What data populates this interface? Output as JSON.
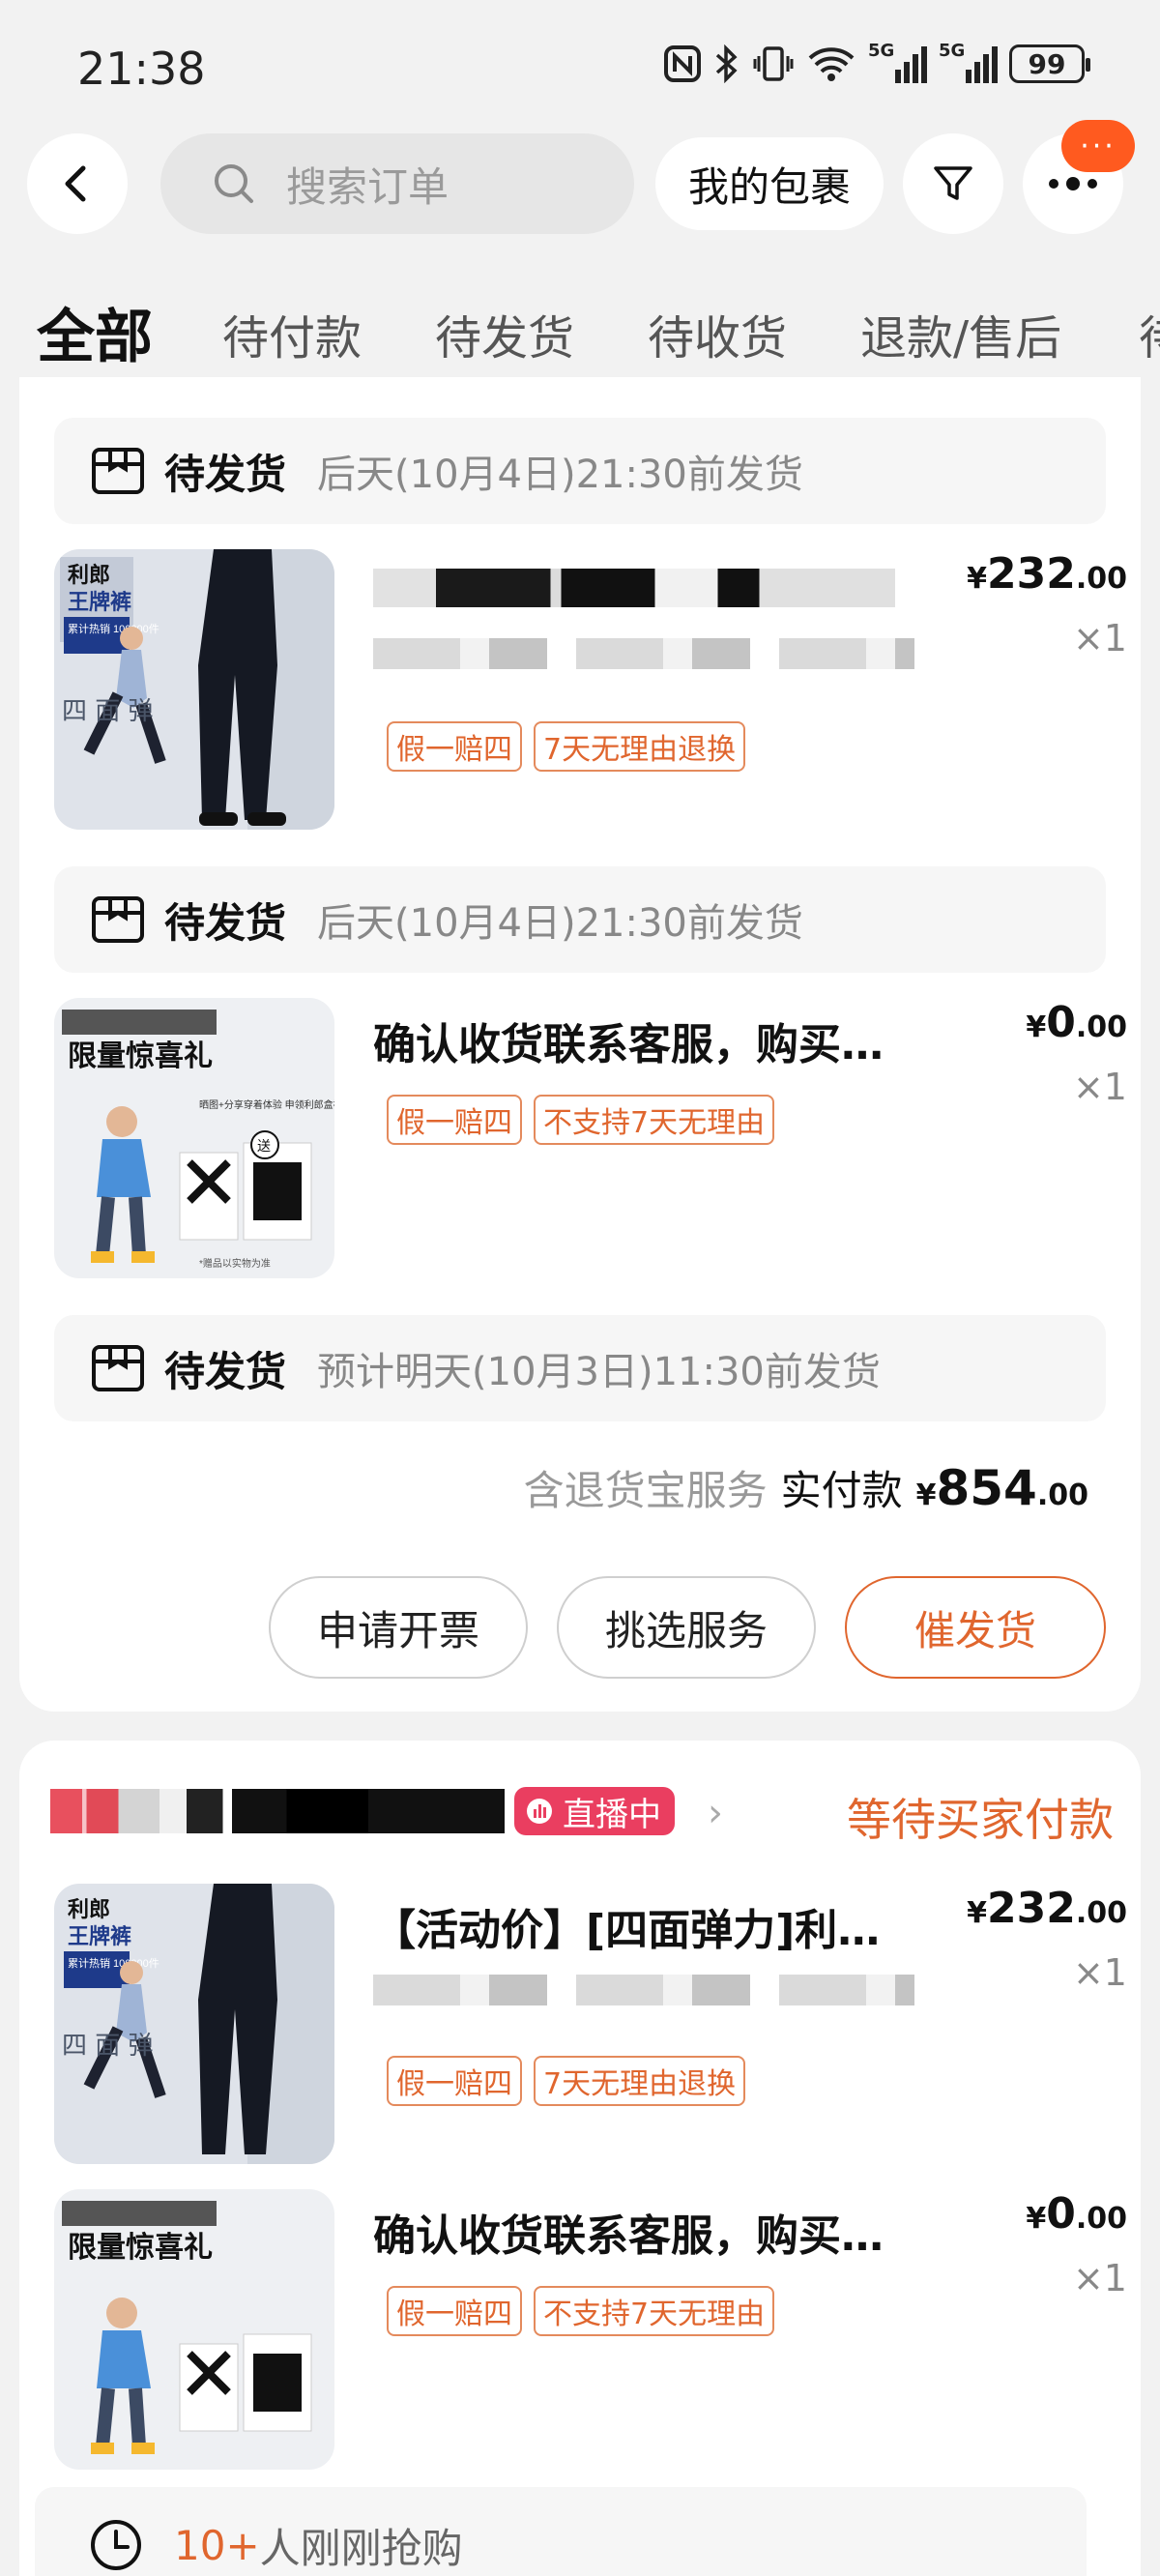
{
  "status_bar": {
    "time": "21:38",
    "battery": "99",
    "signal_1": "5G",
    "signal_2": "5G"
  },
  "header": {
    "search_placeholder": "搜索订单",
    "packages_label": "我的包裹",
    "more_badge": "···"
  },
  "tabs": [
    "全部",
    "待付款",
    "待发货",
    "待收货",
    "退款/售后",
    "待"
  ],
  "order1": {
    "shipments": [
      {
        "status": "待发货",
        "eta": "后天(10月4日)21:30前发货"
      },
      {
        "status": "待发货",
        "eta": "后天(10月4日)21:30前发货"
      },
      {
        "status": "待发货",
        "eta": "预计明天(10月3日)11:30前发货"
      }
    ],
    "items": [
      {
        "title": "",
        "price_currency": "¥",
        "price_int": "232",
        "price_dec": ".00",
        "qty": "×1",
        "tags": [
          "假一赔四",
          "7天无理由退换"
        ],
        "thumb_brand": "利郎",
        "thumb_badge": "王牌裤",
        "thumb_sub": "累计热销 100000件",
        "thumb_side": "四 面 弹"
      },
      {
        "title": "确认收货联系客服，购买指定...",
        "price_currency": "¥",
        "price_int": "0",
        "price_dec": ".00",
        "qty": "×1",
        "tags": [
          "假一赔四",
          "不支持7天无理由"
        ],
        "thumb_headline": "限量惊喜礼",
        "thumb_note": "晒图+分享穿着体验 申领利郎盒袜(2双装)",
        "thumb_gift": "送",
        "thumb_footer": "*赠品以实物为准"
      }
    ],
    "summary": {
      "service": "含退货宝服务",
      "paid_label": "实付款",
      "currency": "¥",
      "amount_int": "854",
      "amount_dec": ".00"
    },
    "actions": [
      "申请开票",
      "挑选服务",
      "催发货"
    ]
  },
  "order2": {
    "live_badge": "直播中",
    "status": "等待买家付款",
    "items": [
      {
        "title": "【活动价】[四面弹力]利郎商务...",
        "price_currency": "¥",
        "price_int": "232",
        "price_dec": ".00",
        "qty": "×1",
        "tags": [
          "假一赔四",
          "7天无理由退换"
        ]
      },
      {
        "title": "确认收货联系客服，购买指定...",
        "price_currency": "¥",
        "price_int": "0",
        "price_dec": ".00",
        "qty": "×1",
        "tags": [
          "假一赔四",
          "不支持7天无理由"
        ]
      }
    ],
    "social": {
      "count": "10+",
      "text": "人刚刚抢购"
    }
  },
  "colors": {
    "accent": "#e0662e",
    "live": "#ea3e60",
    "badge": "#ff5a1f"
  }
}
